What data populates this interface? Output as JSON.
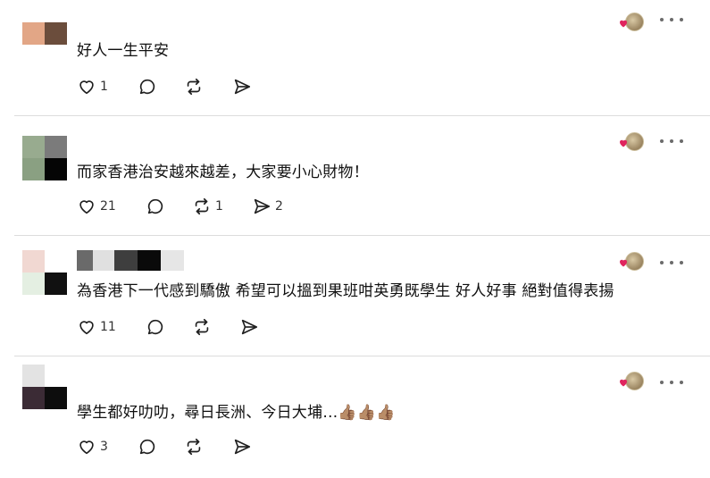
{
  "comments": [
    {
      "text": "好人一生平安",
      "likes": "1",
      "reposts": "",
      "shares": ""
    },
    {
      "text": "而家香港治安越來越差，大家要小心財物！",
      "likes": "21",
      "reposts": "1",
      "shares": "2"
    },
    {
      "text": "為香港下一代感到驕傲 希望可以搵到果班咁英勇既學生 好人好事 絕對值得表揚",
      "likes": "11",
      "reposts": "",
      "shares": ""
    },
    {
      "text": "學生都好叻叻，尋日長洲、今日大埔…👍🏽👍🏽👍🏽",
      "likes": "3",
      "reposts": "",
      "shares": ""
    }
  ],
  "icons": {
    "like": "heart-icon",
    "reply": "comment-bubble-icon",
    "repost": "repost-icon",
    "share": "send-icon",
    "more": "more-dots-icon",
    "reaction": "heart-reaction-icon"
  },
  "colors": {
    "heart": "#e0245e",
    "divider": "#dcdcdc"
  }
}
